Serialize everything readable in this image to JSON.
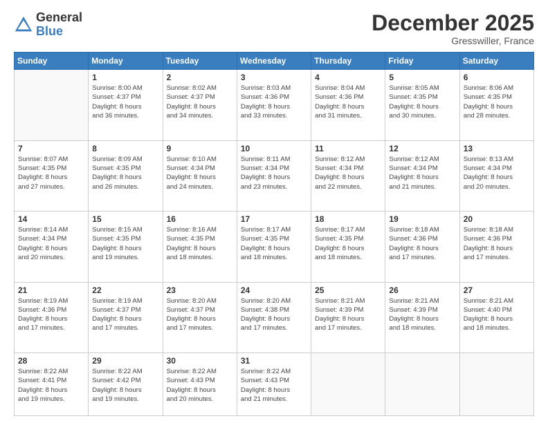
{
  "header": {
    "logo_general": "General",
    "logo_blue": "Blue",
    "month_title": "December 2025",
    "location": "Gresswiller, France"
  },
  "weekdays": [
    "Sunday",
    "Monday",
    "Tuesday",
    "Wednesday",
    "Thursday",
    "Friday",
    "Saturday"
  ],
  "weeks": [
    [
      {
        "day": "",
        "info": ""
      },
      {
        "day": "1",
        "info": "Sunrise: 8:00 AM\nSunset: 4:37 PM\nDaylight: 8 hours\nand 36 minutes."
      },
      {
        "day": "2",
        "info": "Sunrise: 8:02 AM\nSunset: 4:37 PM\nDaylight: 8 hours\nand 34 minutes."
      },
      {
        "day": "3",
        "info": "Sunrise: 8:03 AM\nSunset: 4:36 PM\nDaylight: 8 hours\nand 33 minutes."
      },
      {
        "day": "4",
        "info": "Sunrise: 8:04 AM\nSunset: 4:36 PM\nDaylight: 8 hours\nand 31 minutes."
      },
      {
        "day": "5",
        "info": "Sunrise: 8:05 AM\nSunset: 4:35 PM\nDaylight: 8 hours\nand 30 minutes."
      },
      {
        "day": "6",
        "info": "Sunrise: 8:06 AM\nSunset: 4:35 PM\nDaylight: 8 hours\nand 28 minutes."
      }
    ],
    [
      {
        "day": "7",
        "info": "Sunrise: 8:07 AM\nSunset: 4:35 PM\nDaylight: 8 hours\nand 27 minutes."
      },
      {
        "day": "8",
        "info": "Sunrise: 8:09 AM\nSunset: 4:35 PM\nDaylight: 8 hours\nand 26 minutes."
      },
      {
        "day": "9",
        "info": "Sunrise: 8:10 AM\nSunset: 4:34 PM\nDaylight: 8 hours\nand 24 minutes."
      },
      {
        "day": "10",
        "info": "Sunrise: 8:11 AM\nSunset: 4:34 PM\nDaylight: 8 hours\nand 23 minutes."
      },
      {
        "day": "11",
        "info": "Sunrise: 8:12 AM\nSunset: 4:34 PM\nDaylight: 8 hours\nand 22 minutes."
      },
      {
        "day": "12",
        "info": "Sunrise: 8:12 AM\nSunset: 4:34 PM\nDaylight: 8 hours\nand 21 minutes."
      },
      {
        "day": "13",
        "info": "Sunrise: 8:13 AM\nSunset: 4:34 PM\nDaylight: 8 hours\nand 20 minutes."
      }
    ],
    [
      {
        "day": "14",
        "info": "Sunrise: 8:14 AM\nSunset: 4:34 PM\nDaylight: 8 hours\nand 20 minutes."
      },
      {
        "day": "15",
        "info": "Sunrise: 8:15 AM\nSunset: 4:35 PM\nDaylight: 8 hours\nand 19 minutes."
      },
      {
        "day": "16",
        "info": "Sunrise: 8:16 AM\nSunset: 4:35 PM\nDaylight: 8 hours\nand 18 minutes."
      },
      {
        "day": "17",
        "info": "Sunrise: 8:17 AM\nSunset: 4:35 PM\nDaylight: 8 hours\nand 18 minutes."
      },
      {
        "day": "18",
        "info": "Sunrise: 8:17 AM\nSunset: 4:35 PM\nDaylight: 8 hours\nand 18 minutes."
      },
      {
        "day": "19",
        "info": "Sunrise: 8:18 AM\nSunset: 4:36 PM\nDaylight: 8 hours\nand 17 minutes."
      },
      {
        "day": "20",
        "info": "Sunrise: 8:18 AM\nSunset: 4:36 PM\nDaylight: 8 hours\nand 17 minutes."
      }
    ],
    [
      {
        "day": "21",
        "info": "Sunrise: 8:19 AM\nSunset: 4:36 PM\nDaylight: 8 hours\nand 17 minutes."
      },
      {
        "day": "22",
        "info": "Sunrise: 8:19 AM\nSunset: 4:37 PM\nDaylight: 8 hours\nand 17 minutes."
      },
      {
        "day": "23",
        "info": "Sunrise: 8:20 AM\nSunset: 4:37 PM\nDaylight: 8 hours\nand 17 minutes."
      },
      {
        "day": "24",
        "info": "Sunrise: 8:20 AM\nSunset: 4:38 PM\nDaylight: 8 hours\nand 17 minutes."
      },
      {
        "day": "25",
        "info": "Sunrise: 8:21 AM\nSunset: 4:39 PM\nDaylight: 8 hours\nand 17 minutes."
      },
      {
        "day": "26",
        "info": "Sunrise: 8:21 AM\nSunset: 4:39 PM\nDaylight: 8 hours\nand 18 minutes."
      },
      {
        "day": "27",
        "info": "Sunrise: 8:21 AM\nSunset: 4:40 PM\nDaylight: 8 hours\nand 18 minutes."
      }
    ],
    [
      {
        "day": "28",
        "info": "Sunrise: 8:22 AM\nSunset: 4:41 PM\nDaylight: 8 hours\nand 19 minutes."
      },
      {
        "day": "29",
        "info": "Sunrise: 8:22 AM\nSunset: 4:42 PM\nDaylight: 8 hours\nand 19 minutes."
      },
      {
        "day": "30",
        "info": "Sunrise: 8:22 AM\nSunset: 4:43 PM\nDaylight: 8 hours\nand 20 minutes."
      },
      {
        "day": "31",
        "info": "Sunrise: 8:22 AM\nSunset: 4:43 PM\nDaylight: 8 hours\nand 21 minutes."
      },
      {
        "day": "",
        "info": ""
      },
      {
        "day": "",
        "info": ""
      },
      {
        "day": "",
        "info": ""
      }
    ]
  ]
}
